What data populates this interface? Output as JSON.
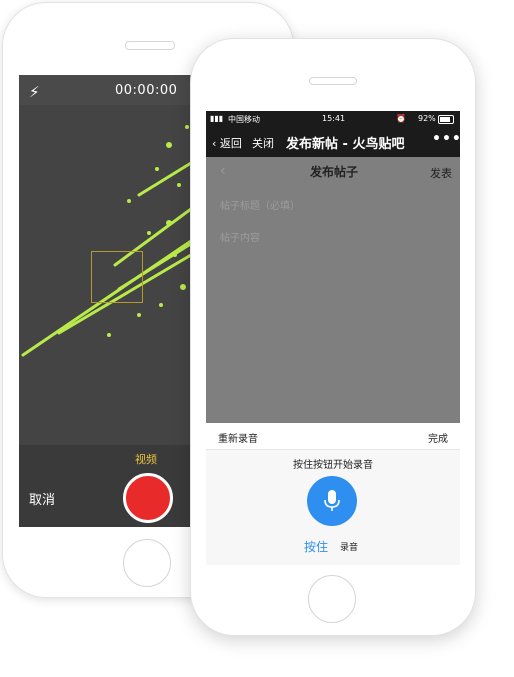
{
  "camera": {
    "timer": "00:00:00",
    "mode": "视频",
    "cancel": "取消",
    "flash_icon": "lightning-icon",
    "record_icon": "record-button"
  },
  "status_bar": {
    "carrier": "中国移动",
    "time": "15:41",
    "battery": "92%"
  },
  "nav": {
    "back": "返回",
    "close": "关闭",
    "title": "发布新帖 - 火鸟贴吧",
    "more": "•••"
  },
  "post": {
    "title": "发布帖子",
    "publish": "发表",
    "title_placeholder": "帖子标题（必填）",
    "content_placeholder": "帖子内容"
  },
  "recorder": {
    "rerecord": "重新录音",
    "done": "完成",
    "hint": "按住按钮开始录音",
    "hold": "按住",
    "record": "录音",
    "accent": "#2f8ff0"
  }
}
